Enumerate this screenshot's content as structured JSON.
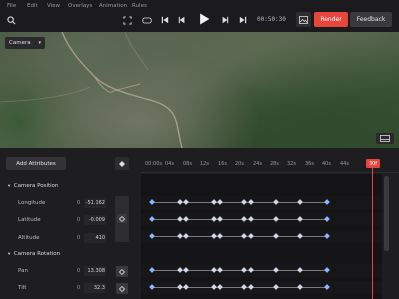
{
  "menu": [
    "File",
    "Edit",
    "View",
    "Overlays",
    "Animation",
    "Rules"
  ],
  "toolbar": {
    "timecode": "00:50:30",
    "render_label": "Render",
    "feedback_label": "Feedback"
  },
  "viewport": {
    "camera_select": "Camera"
  },
  "panel": {
    "add_attributes_label": "Add Attributes",
    "sections": [
      {
        "title": "Camera Position",
        "rows": [
          {
            "label": "Longitude",
            "zero": "0",
            "value": "-51.162"
          },
          {
            "label": "Latitude",
            "zero": "0",
            "value": "-0.009"
          },
          {
            "label": "Altitude",
            "zero": "0",
            "value": "410"
          }
        ]
      },
      {
        "title": "Camera Rotation",
        "rows": [
          {
            "label": "Pan",
            "zero": "0",
            "value": "13.308"
          },
          {
            "label": "Tilt",
            "zero": "0",
            "value": "32.3"
          }
        ]
      }
    ]
  },
  "timeline": {
    "ticks": [
      "00:00s",
      "04s",
      "08s",
      "12s",
      "16s",
      "20s",
      "24s",
      "28s",
      "32s",
      "36s",
      "40s",
      "44s"
    ],
    "playhead_label": "30f"
  },
  "colors": {
    "accent": "#e8453c",
    "keyframe": "#cfd8e8",
    "keyframe_selected": "#8fb4ff"
  }
}
